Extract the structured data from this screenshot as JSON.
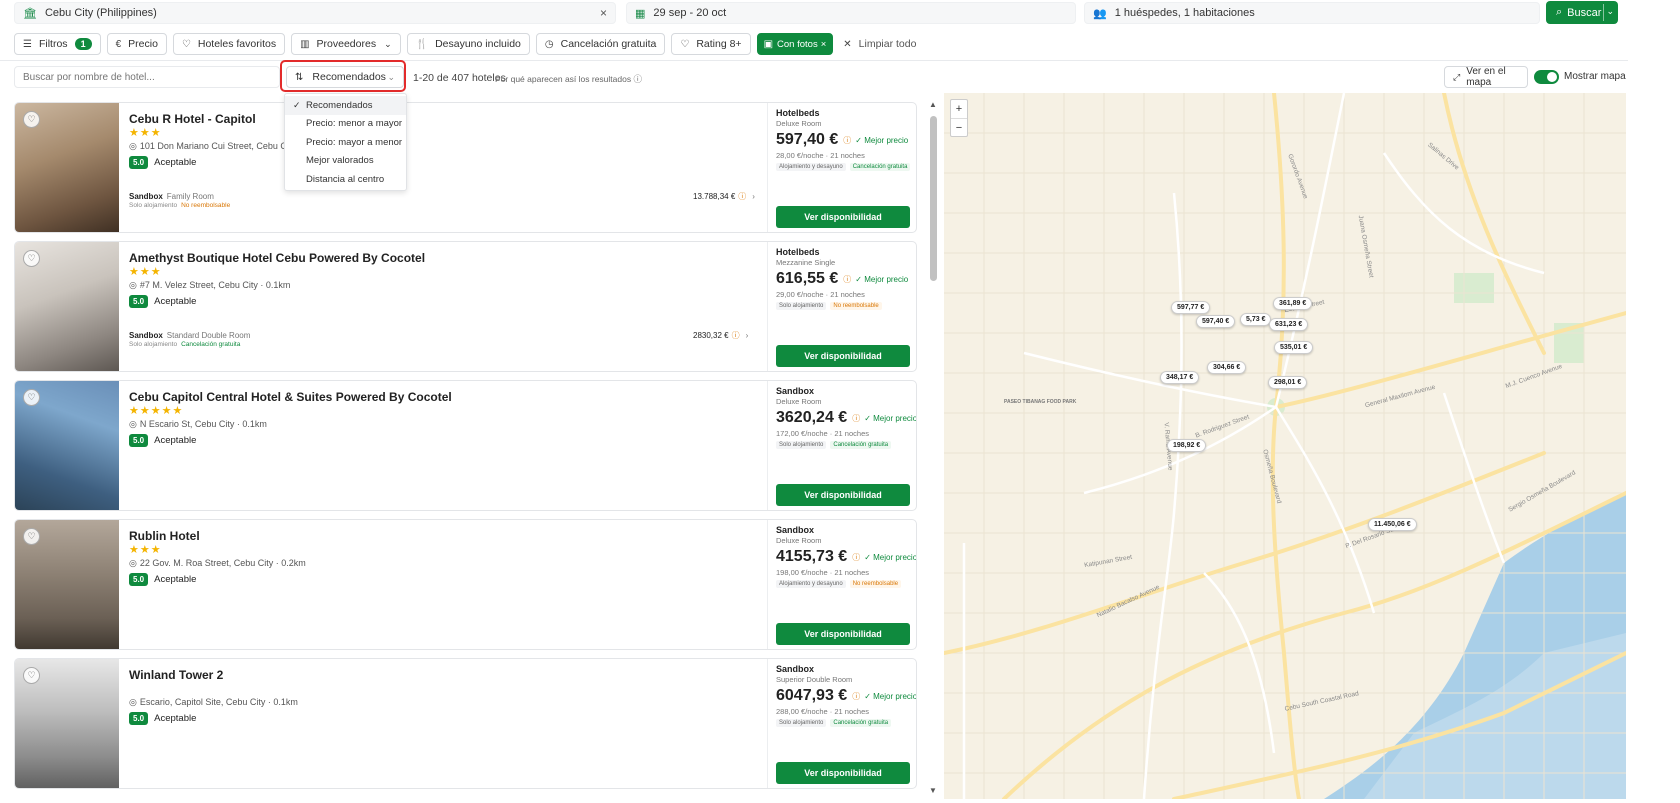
{
  "search": {
    "destination": "Cebu City (Philippines)",
    "dates": "29 sep - 20 oct",
    "guests": "1 huéspedes, 1 habitaciones",
    "search_label": "Buscar",
    "clear_icon": "×"
  },
  "filters": {
    "filters_label": "Filtros",
    "filters_count": "1",
    "items": [
      {
        "label": "Precio",
        "icon": "euro-icon"
      },
      {
        "label": "Hoteles favoritos",
        "icon": "heart-icon"
      },
      {
        "label": "Proveedores",
        "icon": "building-icon"
      },
      {
        "label": "Desayuno incluido",
        "icon": "cutlery-icon"
      },
      {
        "label": "Cancelación gratuita",
        "icon": "clock-icon"
      },
      {
        "label": "Rating 8+",
        "icon": "heart-icon"
      }
    ],
    "active_label": "Con fotos",
    "clear_all": "Limpiar todo"
  },
  "sort": {
    "search_placeholder": "Buscar por nombre de hotel...",
    "selected": "Recomendados",
    "results": "1-20 de 407 hoteles",
    "why": "Por qué aparecen así los resultados",
    "map_button": "Ver en el mapa",
    "show_map": "Mostrar mapa",
    "options": [
      "Recomendados",
      "Precio: menor a mayor",
      "Precio: mayor a menor",
      "Mejor valorados",
      "Distancia al centro"
    ]
  },
  "hotels": [
    {
      "name": "Cebu R Hotel - Capitol",
      "stars": "★★★",
      "address": "101 Don Mariano Cui Street, Cebu City",
      "score": "5.0",
      "score_label": "Aceptable",
      "alt_provider": "Sandbox",
      "alt_room": "Family Room",
      "alt_meta": "Solo alojamiento",
      "alt_tag": "No reembolsable",
      "alt_tag_type": "warn",
      "alt_price": "13.788,34 €",
      "provider": "Hotelbeds",
      "room": "Deluxe Room",
      "price": "597,40 €",
      "night": "28,00 €/noche · 21 noches",
      "tags": [
        {
          "text": "Alojamiento y desayuno",
          "type": ""
        },
        {
          "text": "Cancelación gratuita",
          "type": "ok"
        }
      ],
      "cta": "Ver disponibilidad",
      "best": "Mejor precio"
    },
    {
      "name": "Amethyst Boutique Hotel Cebu Powered By Cocotel",
      "stars": "★★★",
      "address": "#7 M. Velez Street, Cebu City · 0.1km",
      "score": "5.0",
      "score_label": "Aceptable",
      "alt_provider": "Sandbox",
      "alt_room": "Standard Double Room",
      "alt_meta": "Solo alojamiento",
      "alt_tag": "Cancelación gratuita",
      "alt_tag_type": "ok",
      "alt_price": "2830,32 €",
      "provider": "Hotelbeds",
      "room": "Mezzanine Single",
      "price": "616,55 €",
      "night": "29,00 €/noche · 21 noches",
      "tags": [
        {
          "text": "Solo alojamiento",
          "type": ""
        },
        {
          "text": "No reembolsable",
          "type": "warn"
        }
      ],
      "cta": "Ver disponibilidad",
      "best": "Mejor precio"
    },
    {
      "name": "Cebu Capitol Central Hotel & Suites Powered By Cocotel",
      "stars": "★★★★★",
      "address": "N Escario St, Cebu City · 0.1km",
      "score": "5.0",
      "score_label": "Aceptable",
      "alt_provider": "",
      "alt_room": "",
      "alt_meta": "",
      "alt_tag": "",
      "alt_tag_type": "",
      "alt_price": "",
      "provider": "Sandbox",
      "room": "Deluxe Room",
      "price": "3620,24 €",
      "night": "172,00 €/noche · 21 noches",
      "tags": [
        {
          "text": "Solo alojamiento",
          "type": ""
        },
        {
          "text": "Cancelación gratuita",
          "type": "ok"
        }
      ],
      "cta": "Ver disponibilidad",
      "best": "Mejor precio"
    },
    {
      "name": "Rublin Hotel",
      "stars": "★★★",
      "address": "22 Gov. M. Roa Street, Cebu City · 0.2km",
      "score": "5.0",
      "score_label": "Aceptable",
      "alt_provider": "",
      "alt_room": "",
      "alt_meta": "",
      "alt_tag": "",
      "alt_tag_type": "",
      "alt_price": "",
      "provider": "Sandbox",
      "room": "Deluxe Room",
      "price": "4155,73 €",
      "night": "198,00 €/noche · 21 noches",
      "tags": [
        {
          "text": "Alojamiento y desayuno",
          "type": ""
        },
        {
          "text": "No reembolsable",
          "type": "warn"
        }
      ],
      "cta": "Ver disponibilidad",
      "best": "Mejor precio"
    },
    {
      "name": "Winland Tower 2",
      "stars": "",
      "address": "Escario, Capitol Site, Cebu City · 0.1km",
      "score": "5.0",
      "score_label": "Aceptable",
      "alt_provider": "",
      "alt_room": "",
      "alt_meta": "",
      "alt_tag": "",
      "alt_tag_type": "",
      "alt_price": "",
      "provider": "Sandbox",
      "room": "Superior Double Room",
      "price": "6047,93 €",
      "night": "288,00 €/noche · 21 noches",
      "tags": [
        {
          "text": "Solo alojamiento",
          "type": ""
        },
        {
          "text": "Cancelación gratuita",
          "type": "ok"
        }
      ],
      "cta": "Ver disponibilidad",
      "best": "Mejor precio"
    }
  ],
  "map": {
    "pins": [
      "597,77 €",
      "597,40 €",
      "5,73 €",
      "361,89 €",
      "631,23 €",
      "535,01 €",
      "348,17 €",
      "304,66 €",
      "298,01 €",
      "198,92 €",
      "11.450,06 €"
    ],
    "streets": [
      "Salinas Drive",
      "Gorordo Avenue",
      "Juana Osmeña Street",
      "General Maxilom Avenue",
      "B. Rodriguez Street",
      "Osmeña Boulevard",
      "Katipunan Street",
      "Natalio Bacalso Avenue",
      "Cebu South Coastal Road",
      "Sergio Osmeña Boulevard",
      "Escario Street",
      "M.J. Cuenco Avenue",
      "V. Rama Avenue",
      "P. Del Rosario Street"
    ],
    "poi": "PASEO TIBANAG FOOD PARK"
  }
}
